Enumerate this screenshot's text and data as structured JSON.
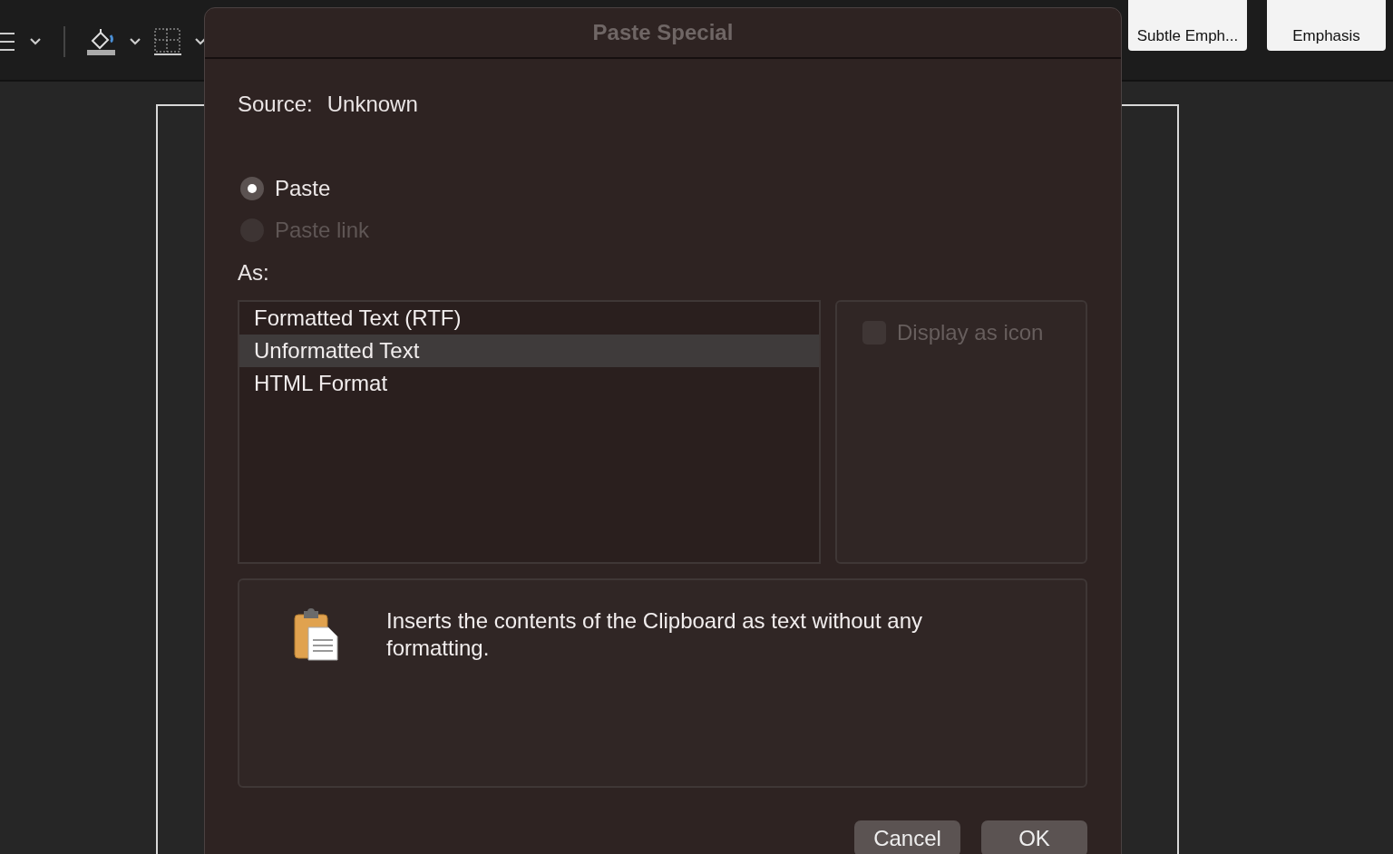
{
  "ribbon": {
    "style_gallery": [
      {
        "label": "Subtle Emph..."
      },
      {
        "label": "Emphasis"
      }
    ]
  },
  "dialog": {
    "title": "Paste Special",
    "source": {
      "label": "Source:",
      "value": "Unknown"
    },
    "paste_options": [
      {
        "label": "Paste",
        "selected": true,
        "disabled": false
      },
      {
        "label": "Paste link",
        "selected": false,
        "disabled": true
      }
    ],
    "as_label": "As:",
    "formats": [
      {
        "label": "Formatted Text (RTF)",
        "selected": false
      },
      {
        "label": "Unformatted Text",
        "selected": true
      },
      {
        "label": "HTML Format",
        "selected": false
      }
    ],
    "display_as_icon": {
      "label": "Display as icon",
      "checked": false,
      "disabled": true
    },
    "description": "Inserts the contents of the Clipboard as text without any formatting.",
    "buttons": [
      {
        "label": "Cancel"
      },
      {
        "label": "OK"
      }
    ]
  }
}
